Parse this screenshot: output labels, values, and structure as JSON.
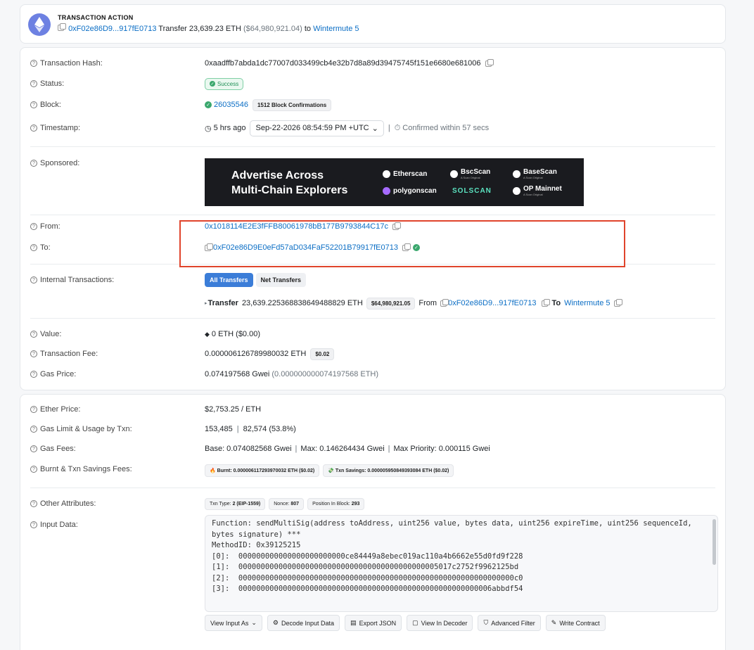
{
  "transaction_action": {
    "title": "TRANSACTION ACTION",
    "contract": "0xF02e86D9...917fE0713",
    "transfer_word": "Transfer",
    "amount": "23,639.23 ETH",
    "usd": "($64,980,921.04)",
    "to_word": "to",
    "recipient": "Wintermute 5"
  },
  "labels": {
    "tx_hash": "Transaction Hash:",
    "status": "Status:",
    "block": "Block:",
    "timestamp": "Timestamp:",
    "sponsored": "Sponsored:",
    "from": "From:",
    "to": "To:",
    "internal": "Internal Transactions:",
    "value": "Value:",
    "tx_fee": "Transaction Fee:",
    "gas_price": "Gas Price:",
    "ether_price": "Ether Price:",
    "gas_limit": "Gas Limit & Usage by Txn:",
    "gas_fees": "Gas Fees:",
    "burnt": "Burnt & Txn Savings Fees:",
    "other_attrs": "Other Attributes:",
    "input_data": "Input Data:"
  },
  "tx_hash": "0xaadffb7abda1dc77007d033499cb4e32b7d8a89d39475745f151e6680e681006",
  "status": "Success",
  "block": {
    "number": "26035546",
    "confirmations": "1512 Block Confirmations"
  },
  "timestamp": {
    "ago": "5 hrs ago",
    "datetime": "Sep-22-2026 08:54:59 PM +UTC",
    "confirmed": "Confirmed within 57 secs"
  },
  "ad": {
    "headline_1": "Advertise Across",
    "headline_2": "Multi-Chain Explorers",
    "brands": [
      "Etherscan",
      "BscScan",
      "BaseScan",
      "polygonscan",
      "SOLSCAN",
      "OP Mainnet"
    ],
    "brand_sub": "A Scan Original"
  },
  "from": "0x1018114E2E3fFFB80061978bB177B9793844C17c",
  "to": "0xF02e86D9E0eFd57aD034FaF52201B79917fE0713",
  "internal": {
    "tab_all": "All Transfers",
    "tab_net": "Net Transfers",
    "transfer_word": "Transfer",
    "amount": "23,639.225368838649488829 ETH",
    "usd": "$64,980,921.05",
    "from_word": "From",
    "from_addr": "0xF02e86D9...917fE0713",
    "to_word": "To",
    "to_name": "Wintermute 5"
  },
  "value": "0 ETH ($0.00)",
  "tx_fee": {
    "amount": "0.000006126789980032 ETH",
    "usd": "$0.02"
  },
  "gas_price": {
    "gwei": "0.074197568 Gwei",
    "eth": "(0.000000000074197568 ETH)"
  },
  "ether_price": "$2,753.25 / ETH",
  "gas_limit": {
    "limit": "153,485",
    "usage": "82,574 (53.8%)"
  },
  "gas_fees": {
    "base": "Base: 0.074082568 Gwei",
    "max": "Max: 0.146264434 Gwei",
    "max_priority": "Max Priority: 0.000115 Gwei"
  },
  "burnt": {
    "burnt": "Burnt: 0.000006117293970032 ETH ($0.02)",
    "savings": "Txn Savings: 0.000005950849393084 ETH ($0.02)"
  },
  "other_attrs": {
    "txn_type_label": "Txn Type:",
    "txn_type": "2 (EIP-1559)",
    "nonce_label": "Nonce:",
    "nonce": "807",
    "position_label": "Position In Block:",
    "position": "293"
  },
  "input_data": {
    "lines": [
      "Function: sendMultiSig(address toAddress, uint256 value, bytes data, uint256 expireTime, uint256 sequenceId,",
      "bytes signature) ***",
      "",
      "MethodID: 0x39125215",
      "[0]:  000000000000000000000000ce84449a8ebec019ac110a4b6662e55d0fd9f228",
      "[1]:  000000000000000000000000000000000000000000005017c2752f9962125bd",
      "[2]:  00000000000000000000000000000000000000000000000000000000000000c0",
      "[3]:  000000000000000000000000000000000000000000000000000000006abbdf54"
    ],
    "buttons": [
      "View Input As",
      "Decode Input Data",
      "Export JSON",
      "View In Decoder",
      "Advanced Filter",
      "Write Contract"
    ]
  }
}
